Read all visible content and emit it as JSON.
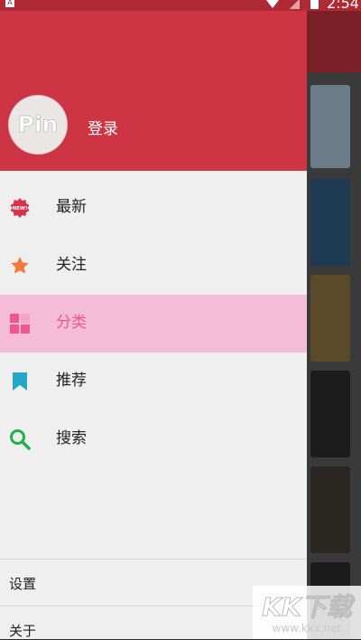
{
  "status_bar": {
    "time": "2:54"
  },
  "drawer": {
    "header": {
      "avatar_text": "Pin",
      "login_label": "登录"
    },
    "menu": [
      {
        "label": "最新",
        "icon": "new-badge-icon"
      },
      {
        "label": "关注",
        "icon": "star-icon"
      },
      {
        "label": "分类",
        "icon": "grid-icon",
        "active": true
      },
      {
        "label": "推荐",
        "icon": "bookmark-icon"
      },
      {
        "label": "搜索",
        "icon": "search-icon"
      }
    ],
    "footer": {
      "settings_label": "设置",
      "about_label": "关于"
    }
  },
  "watermark": {
    "brand": "KK下载",
    "url": "www.kkx.net"
  },
  "colors": {
    "header": "#cd3544",
    "active_bg": "#f5bcd7",
    "active_text": "#f2568f"
  }
}
